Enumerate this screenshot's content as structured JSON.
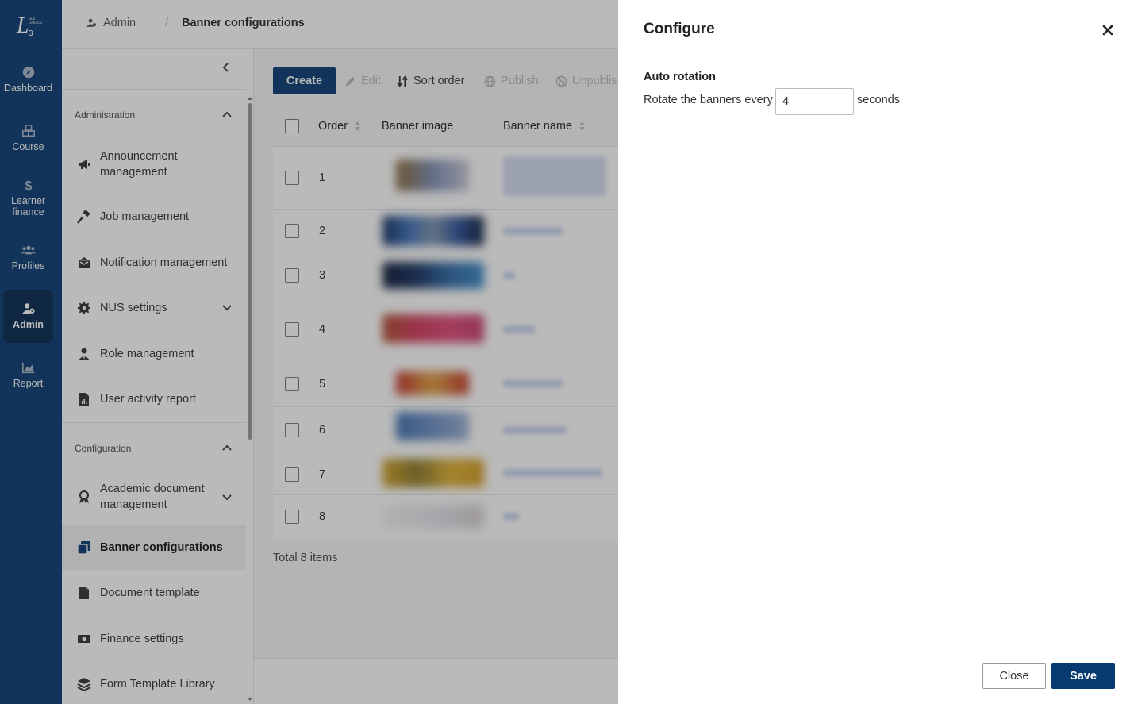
{
  "rail": {
    "items": [
      {
        "label": "Dashboard",
        "icon": "compass-icon"
      },
      {
        "label": "Course",
        "icon": "cubes-icon"
      },
      {
        "label": "Learner finance",
        "icon": "dollar-icon"
      },
      {
        "label": "Profiles",
        "icon": "users-icon"
      },
      {
        "label": "Admin",
        "icon": "user-gear-icon"
      },
      {
        "label": "Report",
        "icon": "chart-area-icon"
      }
    ],
    "active": "Admin"
  },
  "breadcrumb": {
    "root": "Admin",
    "separator": "/",
    "current": "Banner configurations"
  },
  "menu": {
    "sections": [
      {
        "title": "Administration",
        "items": [
          {
            "label": "Announcement management",
            "icon": "megaphone-icon"
          },
          {
            "label": "Job management",
            "icon": "hammer-icon"
          },
          {
            "label": "Notification management",
            "icon": "envelope-open-icon"
          },
          {
            "label": "NUS settings",
            "icon": "gear-icon"
          },
          {
            "label": "Role management",
            "icon": "user-tie-icon"
          },
          {
            "label": "User activity report",
            "icon": "file-report-icon"
          }
        ]
      },
      {
        "title": "Configuration",
        "items": [
          {
            "label": "Academic document management",
            "icon": "award-icon"
          },
          {
            "label": "Banner configurations",
            "icon": "clone-icon"
          },
          {
            "label": "Document template",
            "icon": "file-icon"
          },
          {
            "label": "Finance settings",
            "icon": "money-bill-icon"
          },
          {
            "label": "Form Template Library",
            "icon": "layers-icon"
          }
        ]
      }
    ],
    "active": "Banner configurations"
  },
  "toolbar": {
    "create": "Create",
    "edit": "Edit",
    "sort_order": "Sort order",
    "publish": "Publish",
    "unpublish": "Unpublis"
  },
  "table": {
    "columns": [
      "Order",
      "Banner image",
      "Banner name"
    ],
    "rows": [
      "1",
      "2",
      "3",
      "4",
      "5",
      "6",
      "7",
      "8"
    ],
    "total": "Total 8 items"
  },
  "drawer": {
    "title": "Configure",
    "section": "Auto rotation",
    "label": "Rotate the banners every",
    "value": "4",
    "unit": "seconds",
    "close_label": "Close",
    "save_label": "Save"
  },
  "colors": {
    "brand": "#083a72",
    "rail_active": "#05274f"
  }
}
